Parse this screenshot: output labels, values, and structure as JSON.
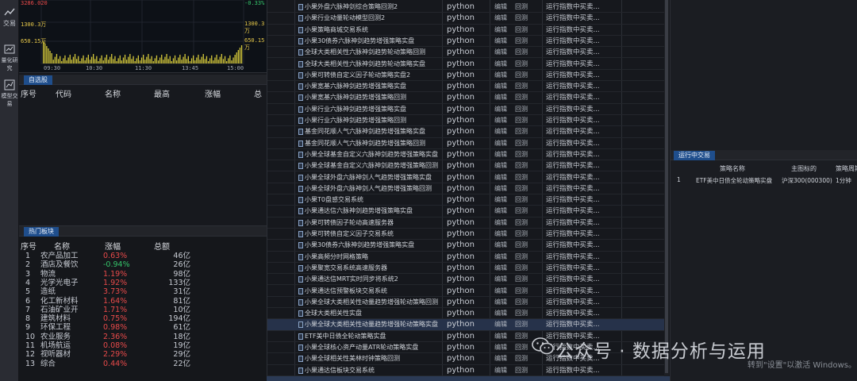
{
  "rail": {
    "items": [
      {
        "label": "交易",
        "icon": "trade-icon"
      },
      {
        "label": "量化研究",
        "icon": "research-icon"
      },
      {
        "label": "模型交易",
        "icon": "model-trade-icon"
      }
    ]
  },
  "chart": {
    "y_top_left": "3286.020",
    "y_top_right": "-0.33%",
    "y_mid_left": "1300.3万",
    "y_mid_right": "1300.3万",
    "y_low_left": "650.15万",
    "y_low_right": "650.15万",
    "x_ticks": [
      "09:30",
      "10:30",
      "11:30",
      "13:45",
      "15:00"
    ]
  },
  "watchlist": {
    "tab": "自选股",
    "columns": [
      "序号",
      "代码",
      "名称",
      "最高",
      "涨幅",
      "总"
    ]
  },
  "hot_sectors": {
    "tab": "热门板块",
    "columns": [
      "序号",
      "名称",
      "涨幅",
      "总额"
    ],
    "rows": [
      {
        "idx": "1",
        "name": "农产品加工",
        "chg": "0.63%",
        "amt": "46亿",
        "dir": "up"
      },
      {
        "idx": "2",
        "name": "酒店及餐饮",
        "chg": "-0.94%",
        "amt": "26亿",
        "dir": "down"
      },
      {
        "idx": "3",
        "name": "物流",
        "chg": "1.19%",
        "amt": "98亿",
        "dir": "up"
      },
      {
        "idx": "4",
        "name": "光学光电子",
        "chg": "1.92%",
        "amt": "133亿",
        "dir": "up"
      },
      {
        "idx": "5",
        "name": "造纸",
        "chg": "3.73%",
        "amt": "31亿",
        "dir": "up"
      },
      {
        "idx": "6",
        "name": "化工新材料",
        "chg": "1.64%",
        "amt": "81亿",
        "dir": "up"
      },
      {
        "idx": "7",
        "name": "石油矿业开",
        "chg": "1.71%",
        "amt": "10亿",
        "dir": "up"
      },
      {
        "idx": "8",
        "name": "建筑材料",
        "chg": "0.75%",
        "amt": "194亿",
        "dir": "up"
      },
      {
        "idx": "9",
        "name": "环保工程",
        "chg": "0.98%",
        "amt": "61亿",
        "dir": "up"
      },
      {
        "idx": "10",
        "name": "农业服务",
        "chg": "2.36%",
        "amt": "18亿",
        "dir": "up"
      },
      {
        "idx": "11",
        "name": "机场航运",
        "chg": "0.08%",
        "amt": "19亿",
        "dir": "up"
      },
      {
        "idx": "12",
        "name": "视听器材",
        "chg": "2.29%",
        "amt": "29亿",
        "dir": "up"
      },
      {
        "idx": "13",
        "name": "综合",
        "chg": "0.44%",
        "amt": "22亿",
        "dir": "up"
      }
    ]
  },
  "strategies": {
    "selected_index": 28,
    "rows": [
      {
        "name": "小果外盘六脉神剑综合策略回测2",
        "lang": "python",
        "edit": "编辑",
        "backtest": "回测",
        "status": "运行指数中买卖..."
      },
      {
        "name": "小果行业动量轮动模型回测2",
        "lang": "python",
        "edit": "编辑",
        "backtest": "回测",
        "status": "运行指数中买卖..."
      },
      {
        "name": "小果策略商城交易系统",
        "lang": "python",
        "edit": "编辑",
        "backtest": "回测",
        "status": "运行指数中买卖..."
      },
      {
        "name": "小果30债券六脉神剑趋势增强策略实盘",
        "lang": "python",
        "edit": "编辑",
        "backtest": "回测",
        "status": "运行指数中买卖..."
      },
      {
        "name": "全球大类相关性六脉神剑趋势轮动策略回测",
        "lang": "python",
        "edit": "编辑",
        "backtest": "回测",
        "status": "运行指数中买卖..."
      },
      {
        "name": "全球大类相关性六脉神剑趋势轮动策略实盘",
        "lang": "python",
        "edit": "编辑",
        "backtest": "回测",
        "status": "运行指数中买卖..."
      },
      {
        "name": "小果可转债自定义因子轮动策略实盘2",
        "lang": "python",
        "edit": "编辑",
        "backtest": "回测",
        "status": "运行指数中买卖..."
      },
      {
        "name": "小果宽基六脉神剑趋势增强策略实盘",
        "lang": "python",
        "edit": "编辑",
        "backtest": "回测",
        "status": "运行指数中买卖..."
      },
      {
        "name": "小果宽基六脉神剑趋势增强策略回测",
        "lang": "python",
        "edit": "编辑",
        "backtest": "回测",
        "status": "运行指数中买卖..."
      },
      {
        "name": "小果行业六脉神剑趋势增强策略实盘",
        "lang": "python",
        "edit": "编辑",
        "backtest": "回测",
        "status": "运行指数中买卖..."
      },
      {
        "name": "小果行业六脉神剑趋势增强策略回测",
        "lang": "python",
        "edit": "编辑",
        "backtest": "回测",
        "status": "运行指数中买卖..."
      },
      {
        "name": "基金同花顺人气六脉神剑趋势增强策略实盘",
        "lang": "python",
        "edit": "编辑",
        "backtest": "回测",
        "status": "运行指数中买卖..."
      },
      {
        "name": "基金同花顺人气六脉神剑趋势增强策略回测",
        "lang": "python",
        "edit": "编辑",
        "backtest": "回测",
        "status": "运行指数中买卖..."
      },
      {
        "name": "小果全球基金自定义六脉神剑趋势增强策略实盘",
        "lang": "python",
        "edit": "编辑",
        "backtest": "回测",
        "status": "运行指数中买卖..."
      },
      {
        "name": "小果全球基金自定义六脉神剑趋势增强策略回测",
        "lang": "python",
        "edit": "编辑",
        "backtest": "回测",
        "status": "运行指数中买卖..."
      },
      {
        "name": "小果全球外盘六脉神剑人气趋势增强策略实盘",
        "lang": "python",
        "edit": "编辑",
        "backtest": "回测",
        "status": "运行指数中买卖..."
      },
      {
        "name": "小果全球外盘六脉神剑人气趋势增强策略回测",
        "lang": "python",
        "edit": "编辑",
        "backtest": "回测",
        "status": "运行指数中买卖..."
      },
      {
        "name": "小果T0盘感交易系统",
        "lang": "python",
        "edit": "编辑",
        "backtest": "回测",
        "status": "运行指数中买卖..."
      },
      {
        "name": "小果通达信六脉神剑趋势增强策略实盘",
        "lang": "python",
        "edit": "编辑",
        "backtest": "回测",
        "status": "运行指数中买卖..."
      },
      {
        "name": "小果可转债因子轮动高速服务器",
        "lang": "python",
        "edit": "编辑",
        "backtest": "回测",
        "status": "运行指数中买卖..."
      },
      {
        "name": "小果可转债自定义因子交易系统",
        "lang": "python",
        "edit": "编辑",
        "backtest": "回测",
        "status": "运行指数中买卖..."
      },
      {
        "name": "小果30债券六脉神剑趋势增强策略实盘",
        "lang": "python",
        "edit": "编辑",
        "backtest": "回测",
        "status": "运行指数中买卖..."
      },
      {
        "name": "小果高频分时网格策略",
        "lang": "python",
        "edit": "编辑",
        "backtest": "回测",
        "status": "运行指数中买卖..."
      },
      {
        "name": "小果聚宽交易系统高速服务器",
        "lang": "python",
        "edit": "编辑",
        "backtest": "回测",
        "status": "运行指数中买卖..."
      },
      {
        "name": "小果通达信MRT实时同步将系统2",
        "lang": "python",
        "edit": "编辑",
        "backtest": "回测",
        "status": "运行指数中买卖..."
      },
      {
        "name": "小果通达信预警板块交易系统",
        "lang": "python",
        "edit": "编辑",
        "backtest": "回测",
        "status": "运行指数中买卖..."
      },
      {
        "name": "小果全球大类相关性动量趋势增强轮动策略回测",
        "lang": "python",
        "edit": "编辑",
        "backtest": "回测",
        "status": "运行指数中买卖..."
      },
      {
        "name": "全球大类相关性实盘",
        "lang": "python",
        "edit": "编辑",
        "backtest": "回测",
        "status": "运行指数中买卖..."
      },
      {
        "name": "小果全球大类相关性动量趋势增强轮动策略实盘",
        "lang": "python",
        "edit": "编辑",
        "backtest": "回测",
        "status": "运行指数中买卖..."
      },
      {
        "name": "ETF美中日债全轮动策略实盘",
        "lang": "python",
        "edit": "编辑",
        "backtest": "回测",
        "status": "运行指数中买卖..."
      },
      {
        "name": "小果全球核心资产动量ATR轮动策略实盘",
        "lang": "python",
        "edit": "编辑",
        "backtest": "回测",
        "status": "运行指数中买卖..."
      },
      {
        "name": "小果全球相关性美林时钟策略回测",
        "lang": "python",
        "edit": "编辑",
        "backtest": "回测",
        "status": "运行指数中买卖..."
      },
      {
        "name": "小果通达信板块交易系统",
        "lang": "python",
        "edit": "编辑",
        "backtest": "回测",
        "status": "运行指数中买卖..."
      }
    ]
  },
  "running": {
    "tab": "运行中交易",
    "columns": [
      "策略名称",
      "主图标的",
      "策略周期"
    ],
    "rows": [
      {
        "idx": "1",
        "name": "ETF美中日债全轮动策略实盘",
        "symbol": "沪深300(000300)",
        "period": "1分钟"
      }
    ]
  },
  "watermark": "公众号 · 数据分析与运用",
  "activate_hint": "转到\"设置\"以激活 Windows。",
  "colors": {
    "up": "#e84a4a",
    "down": "#35c46a",
    "accent": "#1f4e8c"
  }
}
